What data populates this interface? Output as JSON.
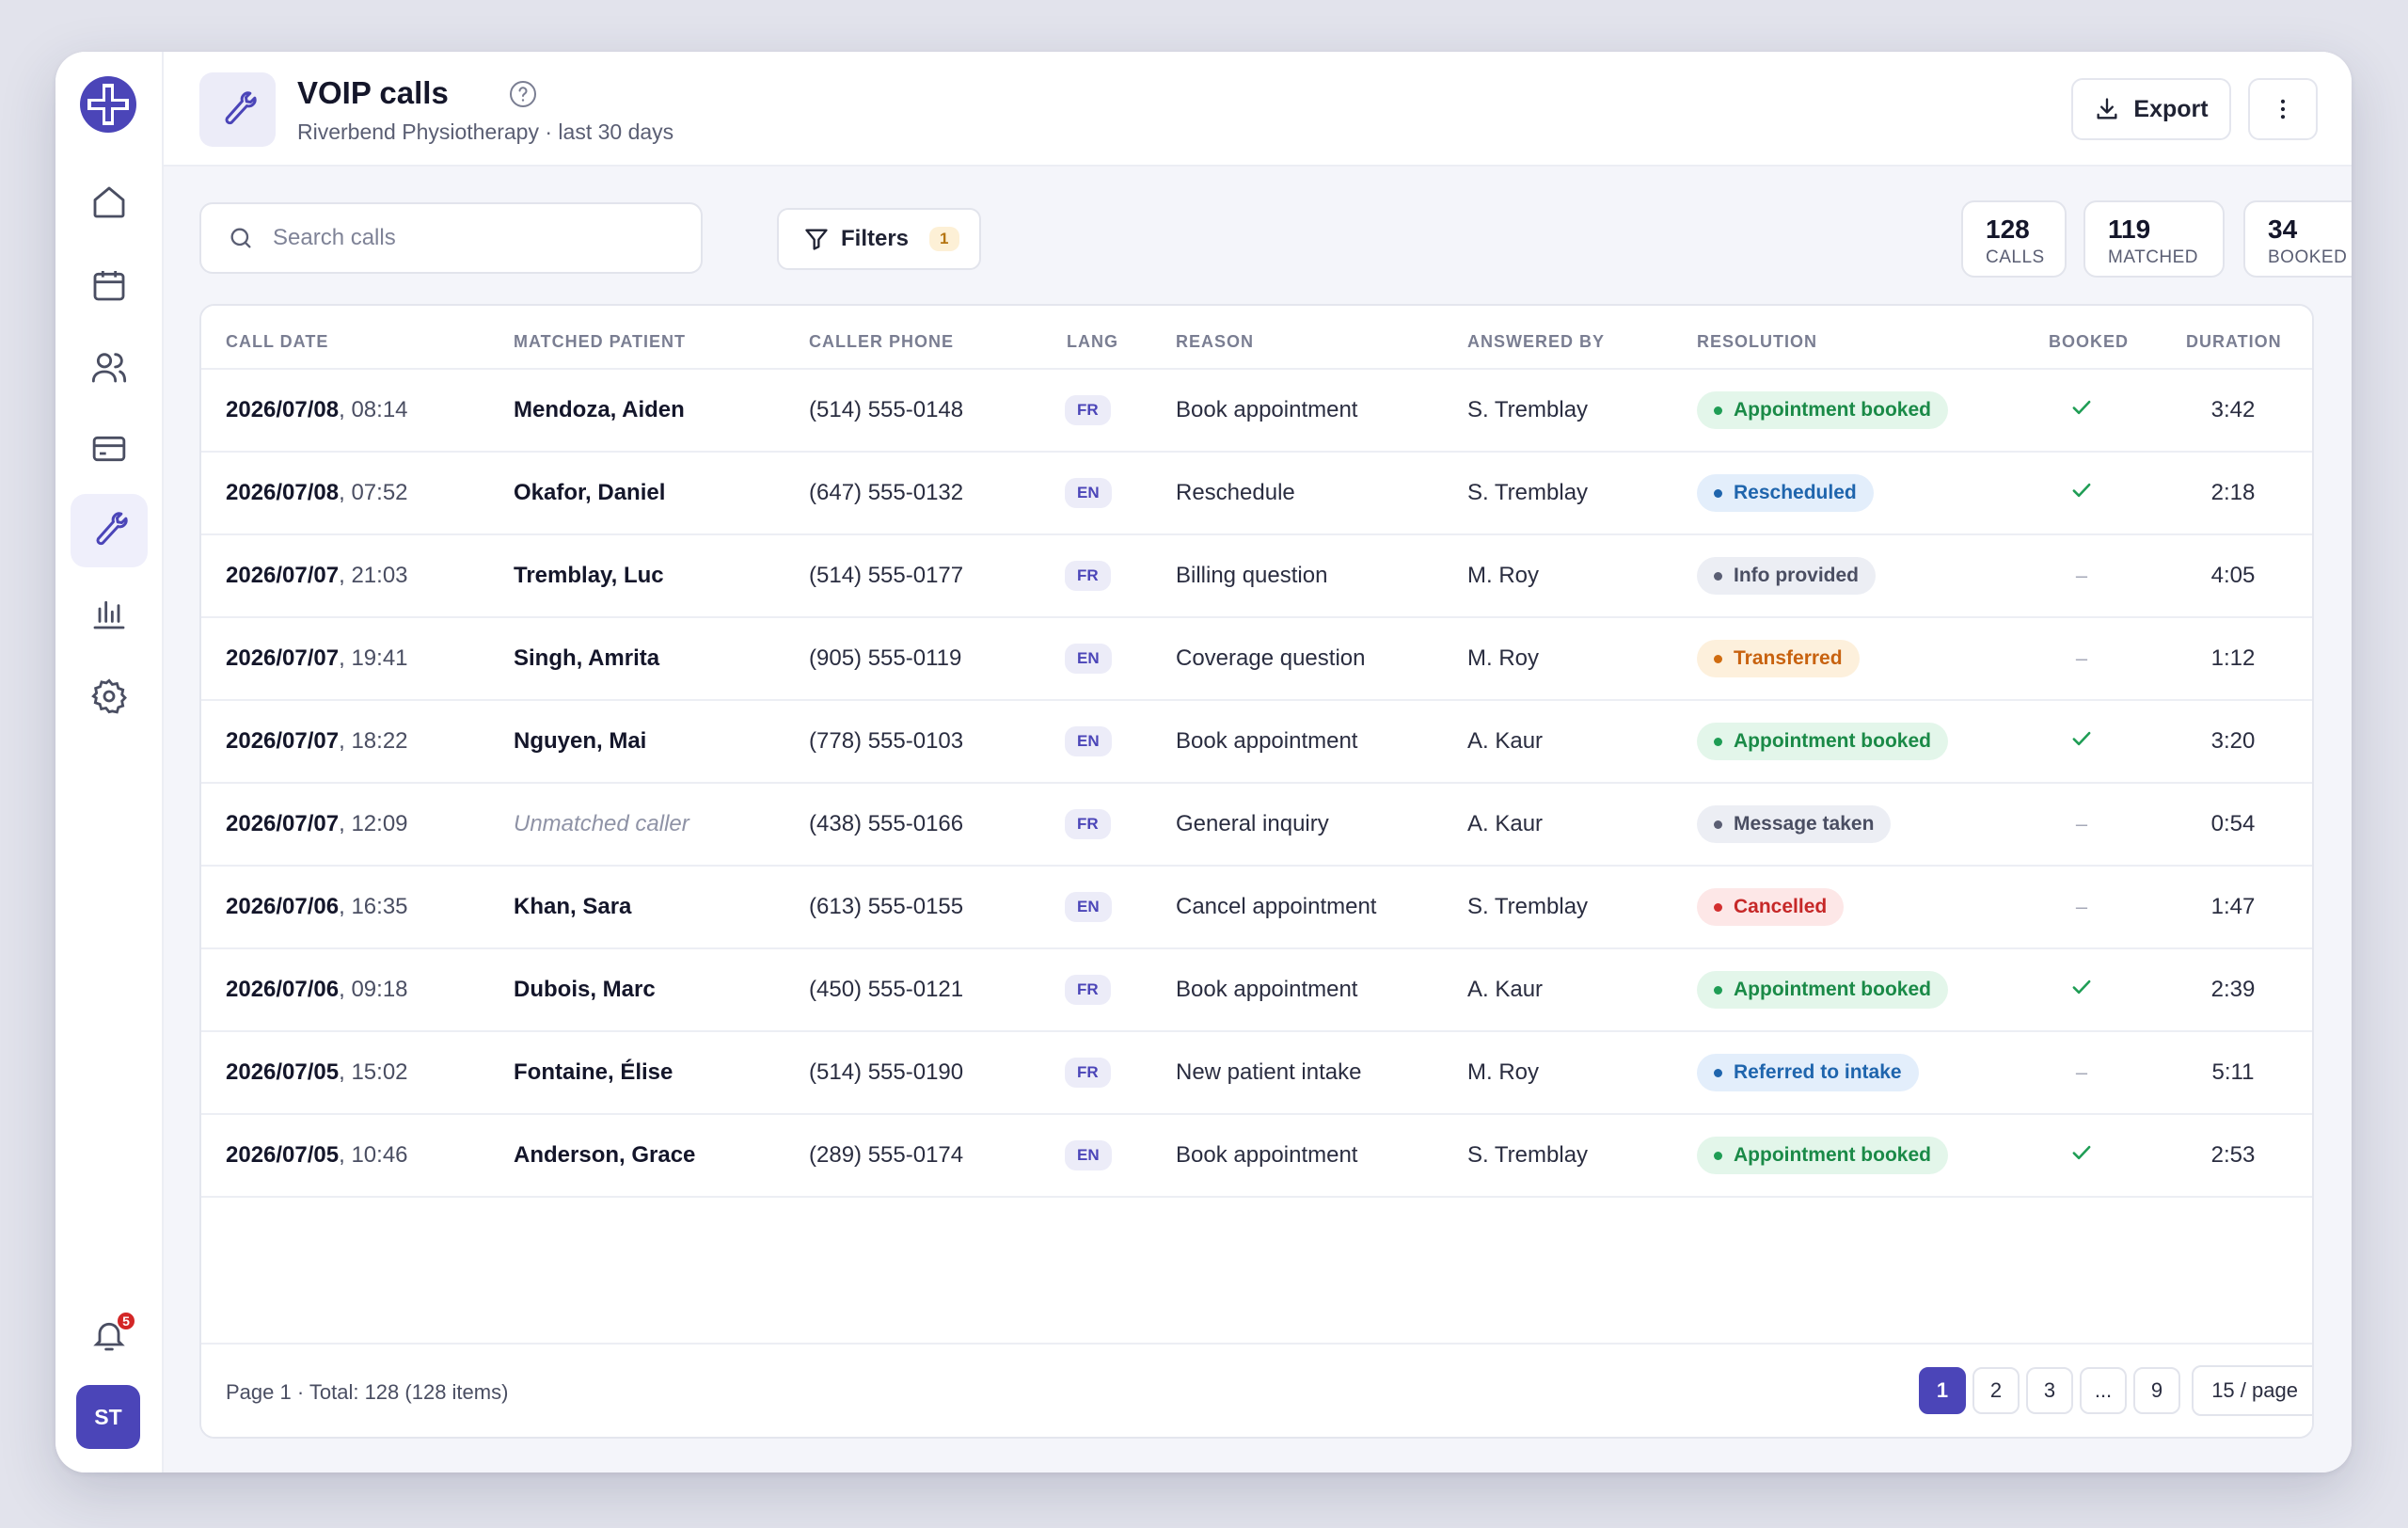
{
  "header": {
    "title": "VOIP calls",
    "subtitle": "Riverbend Physiotherapy · last 30 days",
    "export_label": "Export"
  },
  "sidebar": {
    "items": [
      {
        "name": "home-icon"
      },
      {
        "name": "calendar-icon"
      },
      {
        "name": "users-icon"
      },
      {
        "name": "card-icon"
      },
      {
        "name": "wrench-icon",
        "active": true
      },
      {
        "name": "chart-icon"
      },
      {
        "name": "gear-icon"
      }
    ],
    "notifications_count": "5",
    "avatar_initials": "ST"
  },
  "toolbar": {
    "search_placeholder": "Search calls",
    "filters_label": "Filters",
    "filters_count": "1"
  },
  "stats": [
    {
      "value": "128",
      "label": "CALLS"
    },
    {
      "value": "119",
      "label": "MATCHED"
    },
    {
      "value": "34",
      "label": "BOOKED"
    }
  ],
  "table": {
    "columns": [
      "CALL DATE",
      "MATCHED PATIENT",
      "CALLER PHONE",
      "LANG",
      "REASON",
      "ANSWERED BY",
      "RESOLUTION",
      "BOOKED",
      "DURATION"
    ],
    "rows": [
      {
        "date": "2026/07/08",
        "time": ", 08:14",
        "patient": "Mendoza, Aiden",
        "phone": "(514) 555-0148",
        "lang": "FR",
        "reason": "Book appointment",
        "answered": "S. Tremblay",
        "resolution": "Appointment booked",
        "status": "green",
        "booked": true,
        "duration": "3:42"
      },
      {
        "date": "2026/07/08",
        "time": ", 07:52",
        "patient": "Okafor, Daniel",
        "phone": "(647) 555-0132",
        "lang": "EN",
        "reason": "Reschedule",
        "answered": "S. Tremblay",
        "resolution": "Rescheduled",
        "status": "blue",
        "booked": true,
        "duration": "2:18"
      },
      {
        "date": "2026/07/07",
        "time": ", 21:03",
        "patient": "Tremblay, Luc",
        "phone": "(514) 555-0177",
        "lang": "FR",
        "reason": "Billing question",
        "answered": "M. Roy",
        "resolution": "Info provided",
        "status": "gray",
        "booked": false,
        "duration": "4:05"
      },
      {
        "date": "2026/07/07",
        "time": ", 19:41",
        "patient": "Singh, Amrita",
        "phone": "(905) 555-0119",
        "lang": "EN",
        "reason": "Coverage question",
        "answered": "M. Roy",
        "resolution": "Transferred",
        "status": "orange",
        "booked": false,
        "duration": "1:12"
      },
      {
        "date": "2026/07/07",
        "time": ", 18:22",
        "patient": "Nguyen, Mai",
        "phone": "(778) 555-0103",
        "lang": "EN",
        "reason": "Book appointment",
        "answered": "A. Kaur",
        "resolution": "Appointment booked",
        "status": "green",
        "booked": true,
        "duration": "3:20"
      },
      {
        "date": "2026/07/07",
        "time": ", 12:09",
        "patient": "Unmatched caller",
        "unmatched": true,
        "phone": "(438) 555-0166",
        "lang": "FR",
        "reason": "General inquiry",
        "answered": "A. Kaur",
        "resolution": "Message taken",
        "status": "gray",
        "booked": false,
        "duration": "0:54"
      },
      {
        "date": "2026/07/06",
        "time": ", 16:35",
        "patient": "Khan, Sara",
        "phone": "(613) 555-0155",
        "lang": "EN",
        "reason": "Cancel appointment",
        "answered": "S. Tremblay",
        "resolution": "Cancelled",
        "status": "red",
        "booked": false,
        "duration": "1:47"
      },
      {
        "date": "2026/07/06",
        "time": ", 09:18",
        "patient": "Dubois, Marc",
        "phone": "(450) 555-0121",
        "lang": "FR",
        "reason": "Book appointment",
        "answered": "A. Kaur",
        "resolution": "Appointment booked",
        "status": "green",
        "booked": true,
        "duration": "2:39"
      },
      {
        "date": "2026/07/05",
        "time": ", 15:02",
        "patient": "Fontaine, Élise",
        "phone": "(514) 555-0190",
        "lang": "FR",
        "reason": "New patient intake",
        "answered": "M. Roy",
        "resolution": "Referred to intake",
        "status": "blue",
        "booked": false,
        "duration": "5:11"
      },
      {
        "date": "2026/07/05",
        "time": ", 10:46",
        "patient": "Anderson, Grace",
        "phone": "(289) 555-0174",
        "lang": "EN",
        "reason": "Book appointment",
        "answered": "S. Tremblay",
        "resolution": "Appointment booked",
        "status": "green",
        "booked": true,
        "duration": "2:53"
      }
    ],
    "dash": "–"
  },
  "footer": {
    "summary": "Page 1 · Total: 128 (128 items)",
    "pages": [
      "1",
      "2",
      "3",
      "...",
      "9"
    ],
    "current_page": "1",
    "per_page": "15 / page"
  }
}
